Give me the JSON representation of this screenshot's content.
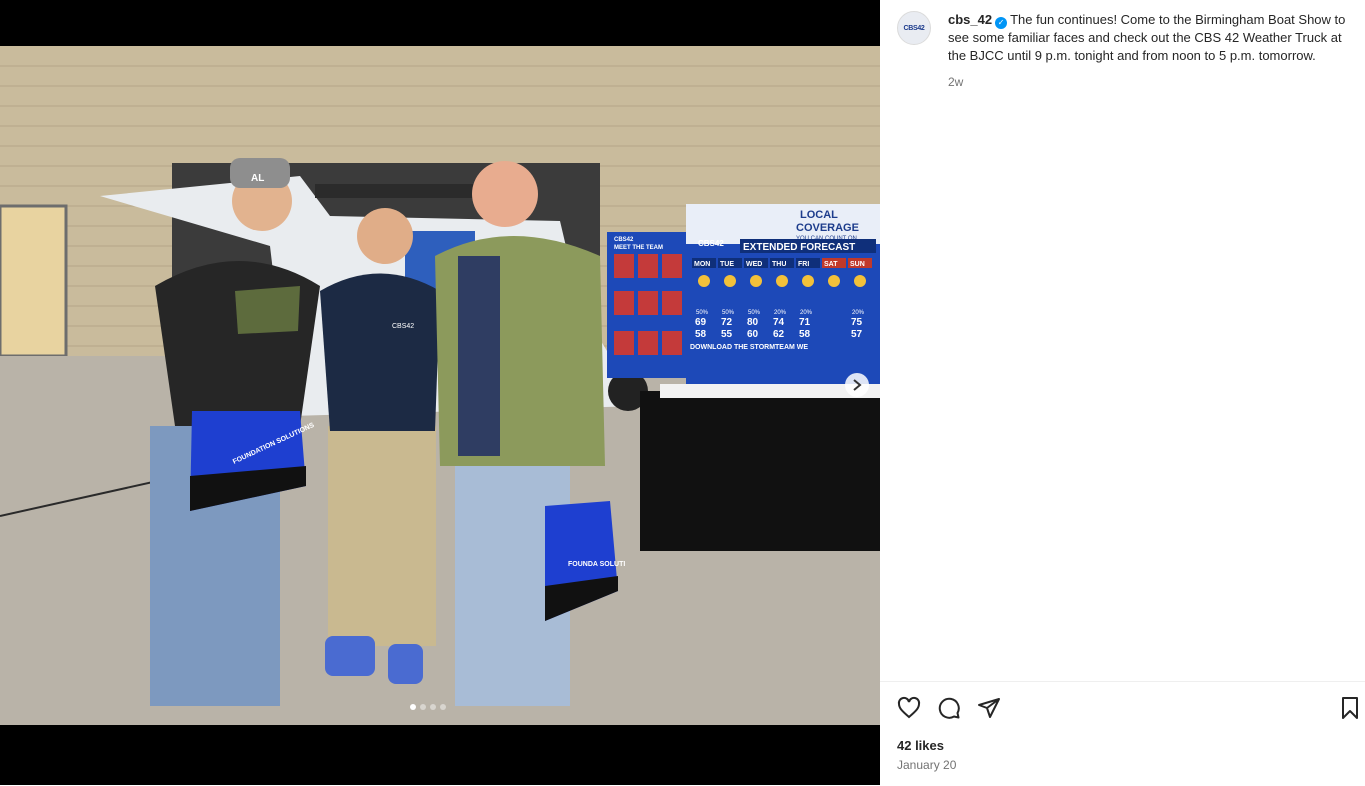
{
  "post": {
    "username": "cbs_42",
    "avatar_text": "CBS42",
    "verified_icon": "verified-badge-icon",
    "caption": "The fun continues! Come to the Birmingham Boat Show to see some familiar faces and check out the CBS 42 Weather Truck at the BJCC until 9 p.m. tonight and from noon to 5 p.m. tomorrow.",
    "age": "2w",
    "likes": "42 likes",
    "date": "January 20"
  },
  "actions": {
    "like_icon": "heart-icon",
    "comment_icon": "comment-icon",
    "share_icon": "share-icon",
    "save_icon": "bookmark-icon"
  },
  "carousel": {
    "slide_count": 4,
    "active_index": 0,
    "next_icon": "chevron-right-icon"
  },
  "photo": {
    "board_title_line1": "LOCAL",
    "board_title_line2": "COVERAGE",
    "board_subtitle": "YOU CAN COUNT ON",
    "board_brand": "CBS42",
    "board_heading": "EXTENDED FORECAST",
    "board_footer": "DOWNLOAD THE STORMTEAM WE",
    "poster_brand": "CBS42",
    "poster_title": "MEET THE TEAM",
    "days": [
      "MON",
      "TUE",
      "WED",
      "THU",
      "FRI",
      "SAT",
      "SUN"
    ],
    "precip": [
      "50%",
      "50%",
      "50%",
      "20%",
      "20%",
      "",
      "20%"
    ],
    "highs": [
      "69",
      "72",
      "80",
      "74",
      "71",
      "",
      "75"
    ],
    "lows": [
      "58",
      "55",
      "60",
      "62",
      "58",
      "",
      "57"
    ],
    "bag_text_1": "FOUNDATION SOLUTIONS",
    "bag_text_2": "FOUNDA SOLUTI",
    "hat_logo": "AL",
    "shirt_logo": "CBS42",
    "colors": {
      "board_blue": "#1d49b8",
      "bag_blue": "#1e3fd0",
      "jacket": "#8c9a5c",
      "polo": "#1c2a44"
    }
  }
}
